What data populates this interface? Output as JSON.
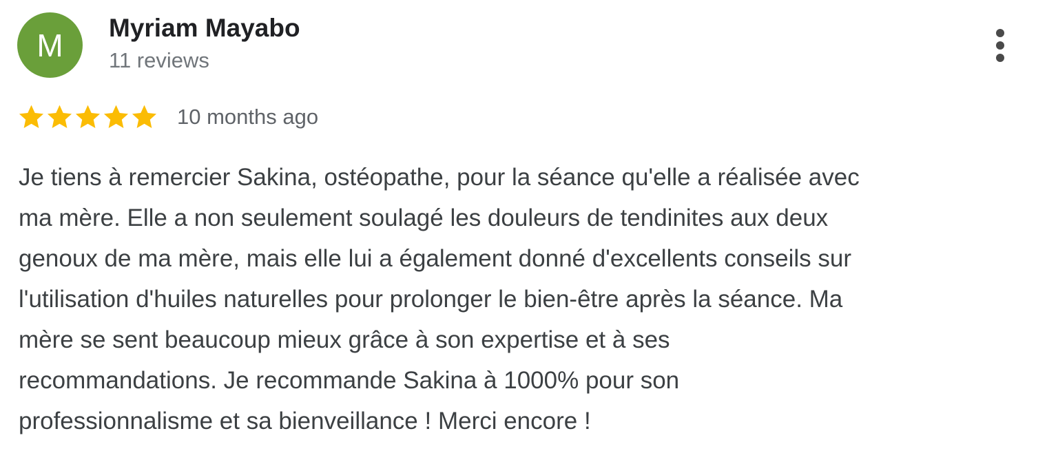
{
  "review": {
    "avatar": {
      "initial": "M",
      "background_color": "#6a9f3a"
    },
    "author_name": "Myriam Mayabo",
    "review_count": "11 reviews",
    "rating": {
      "value": 5,
      "max": 5,
      "star_color": "#fbbc04",
      "star_icon": "star-icon"
    },
    "relative_time": "10 months ago",
    "menu_icon": "more-vert-icon",
    "text_lines": [
      "Je tiens à remercier Sakina, ostéopathe, pour la séance qu'elle a réalisée avec",
      "ma mère. Elle a non seulement soulagé les douleurs de tendinites aux deux",
      "genoux de ma mère, mais elle lui a également donné d'excellents conseils sur",
      "l'utilisation d'huiles naturelles pour prolonger le bien-être après la séance. Ma",
      "mère se sent beaucoup mieux grâce à son expertise et à ses",
      "recommandations. Je recommande Sakina à 1000% pour son",
      "professionnalisme et sa bienveillance ! Merci encore !"
    ]
  }
}
